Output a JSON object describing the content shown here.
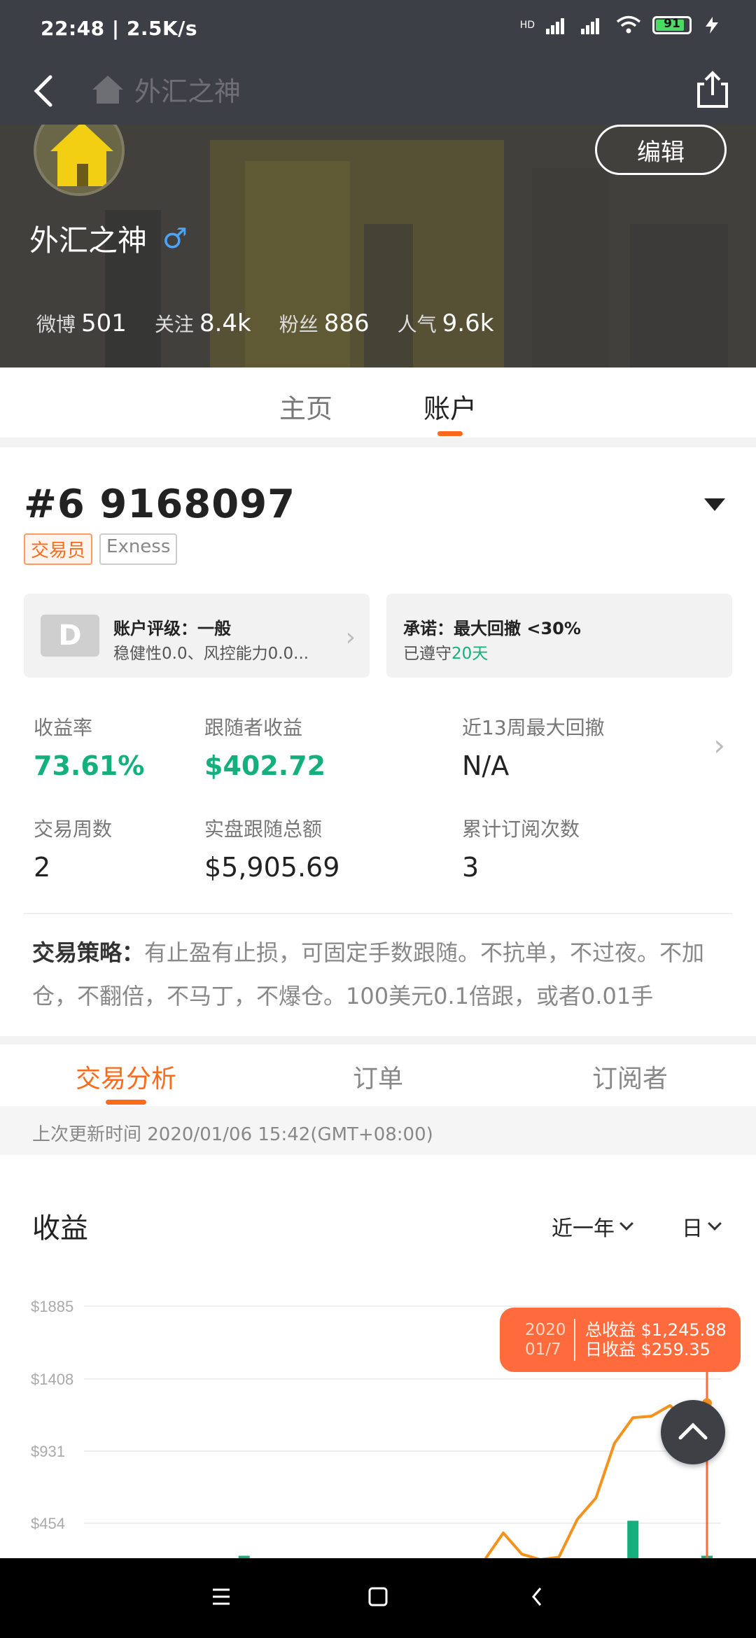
{
  "status_bar": {
    "time": "22:48 | 2.5K/s",
    "battery": "91",
    "network": "HD"
  },
  "nav": {
    "title": "外汇之神"
  },
  "profile": {
    "name": "外汇之神",
    "gender_symbol": "♂",
    "edit_label": "编辑",
    "stats": [
      {
        "label": "微博",
        "value": "501"
      },
      {
        "label": "关注",
        "value": "8.4k"
      },
      {
        "label": "粉丝",
        "value": "886"
      },
      {
        "label": "人气",
        "value": "9.6k"
      }
    ]
  },
  "main_tabs": [
    {
      "label": "主页"
    },
    {
      "label": "账户"
    }
  ],
  "main_tab_active": "账户",
  "account": {
    "number": "#6 9168097",
    "tags": [
      "交易员",
      "Exness"
    ],
    "rating": {
      "badge": "D",
      "title": "账户评级：一般",
      "sub": "稳健性0.0、风控能力0.0..."
    },
    "promise": {
      "title": "承诺：最大回撤 <30%",
      "sub_prefix": "已遵守",
      "sub_days": "20天"
    },
    "metrics": [
      {
        "label": "收益率",
        "value": "73.61%",
        "highlight": true
      },
      {
        "label": "跟随者收益",
        "value": "$402.72",
        "highlight": true
      },
      {
        "label": "近13周最大回撤",
        "value": "N/A",
        "highlight": false
      },
      {
        "label": "交易周数",
        "value": "2",
        "highlight": false
      },
      {
        "label": "实盘跟随总额",
        "value": "$5,905.69",
        "highlight": false
      },
      {
        "label": "累计订阅次数",
        "value": "3",
        "highlight": false
      }
    ],
    "strategy_label": "交易策略：",
    "strategy_text": "有止盈有止损，可固定手数跟随。不抗单，不过夜。不加仓，不翻倍，不马丁，不爆仓。100美元0.1倍跟，或者0.01手"
  },
  "sub_tabs": [
    {
      "label": "交易分析"
    },
    {
      "label": "订单"
    },
    {
      "label": "订阅者"
    }
  ],
  "update_time": "上次更新时间 2020/01/06 15:42(GMT+08:00)",
  "income": {
    "title": "收益",
    "range": "近一年",
    "period": "日"
  },
  "tooltip": {
    "date_year": "2020",
    "date_md": "01/7",
    "total_label": "总收益",
    "total_value": "$1,245.88",
    "daily_label": "日收益",
    "daily_value": "$259.35"
  },
  "colors": {
    "accent": "#ff6a1a",
    "green": "#13b07e",
    "line": "#f5921e",
    "tooltip": "#ff6b3d"
  },
  "chart_data": {
    "type": "line",
    "title": "收益",
    "y_ticks": [
      "$1885",
      "$1408",
      "$931",
      "$454"
    ],
    "ylim": [
      0,
      1885
    ],
    "series": [
      {
        "type": "line",
        "values": [
          0,
          0,
          0,
          0,
          0,
          0,
          0,
          0,
          0,
          0,
          0,
          0,
          0,
          0,
          0,
          0,
          0,
          0,
          20,
          180,
          390,
          250,
          210,
          230,
          480,
          620,
          980,
          1150,
          1160,
          1230,
          1120,
          1245.88
        ]
      },
      {
        "type": "bar",
        "values": [
          0,
          0,
          0,
          0,
          0,
          0,
          30,
          0,
          0,
          0,
          0,
          0,
          0,
          0,
          0,
          0,
          0,
          0,
          0,
          0,
          0,
          0,
          0,
          0,
          0,
          0,
          0,
          230,
          0,
          0,
          0,
          30
        ]
      }
    ]
  }
}
